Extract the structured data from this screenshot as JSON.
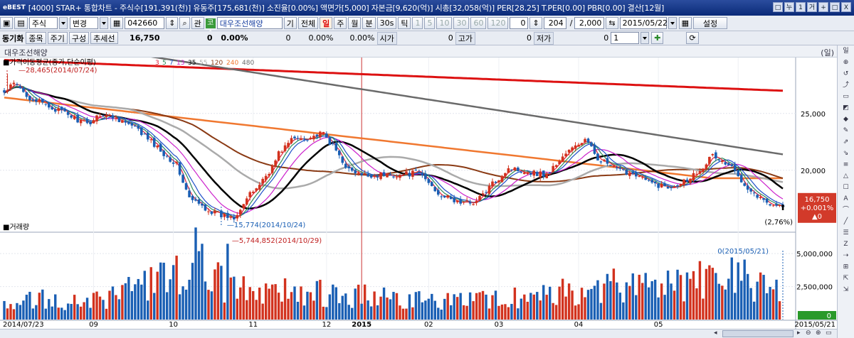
{
  "window": {
    "logo": "eBEST",
    "title": "[4000] STAR+ 통합차트 - 주식수[191,391(천)] 유동주[175,681(천)] 소진율[0.00%] 액면가[5,000] 자본금[9,620(억)] 시총[32,058(억)] PER[28.25] T.PER[0.00] PBR[0.00] 결산[12월]",
    "buttons": [
      "□",
      "누",
      "1",
      "거",
      "+",
      "□",
      "X"
    ]
  },
  "toolbar1": {
    "market": "주식",
    "mode": "변경",
    "code": "042660",
    "search_btn": "관",
    "name_badge": "코스",
    "stock_name": "대우조선해양",
    "buttons": [
      "기",
      "전체",
      "일",
      "주",
      "월",
      "분",
      "30s",
      "틱"
    ],
    "periods": [
      "1",
      "5",
      "10",
      "30",
      "60",
      "120"
    ],
    "count_a": "0",
    "count_b": "204",
    "count_c": "2,000",
    "date": "2015/05/22",
    "settings": "설정"
  },
  "toolbar2": {
    "sync": "동기화",
    "buttons": [
      "종목",
      "주기",
      "구성",
      "추세선"
    ],
    "price": "16,750",
    "change": "0",
    "change_pct": "0.00%",
    "v1": "0",
    "v1p": "0.00%",
    "v2p": "0.00%",
    "labels": [
      "시가",
      "고가",
      "저가"
    ],
    "open": "0",
    "high": "0",
    "low": "0",
    "spin": "1"
  },
  "header": {
    "name": "대우조선해양",
    "period": "(일)"
  },
  "price_panel": {
    "title": "가격이동평균(종가,단순이평)",
    "ma_list": [
      "3",
      "5",
      "7",
      "13",
      "35",
      "55",
      "120",
      "240",
      "480"
    ],
    "high_label": "28,465(2014/07/24)",
    "low_label": "15,774(2014/10/24)",
    "price_tag": [
      "16,750",
      "+0.001%",
      "▲0"
    ],
    "pct_label": "(2,76%)",
    "y_ticks": [
      "25,000",
      "20,000"
    ]
  },
  "volume_panel": {
    "title": "거래량",
    "max_label": "5,744,852(2014/10/29)",
    "last_label": "0(2015/05/21)",
    "y_ticks": [
      "5,000,000",
      "2,500,000"
    ],
    "zero_tag": "0"
  },
  "x_axis": {
    "labels": [
      "2014/07/23",
      "09",
      "10",
      "11",
      "12",
      "2015",
      "02",
      "03",
      "04",
      "05",
      "2015/05/21"
    ]
  },
  "right_tools": [
    "일",
    "⊕",
    "↺",
    "⤴",
    "▭",
    "◩",
    "◆",
    "✎",
    "⇗",
    "⇘",
    "≡",
    "△",
    "☐",
    "A",
    "⌒",
    "╱",
    "☰",
    "Z",
    "⇢",
    "⊞",
    "⇱",
    "⇲"
  ],
  "colors": {
    "up": "#d2321e",
    "down": "#1a5fb4",
    "ma3": "#e0203a",
    "ma5": "#2e8b57",
    "ma7": "#1e50c8",
    "ma13": "#cc22cc",
    "ma35": "#000000",
    "ma55": "#aaaaaa",
    "ma120": "#8a3a14",
    "ma240": "#f07830",
    "ma480": "#6a6a6a",
    "ma_long": "#dd1111"
  },
  "chart_data": {
    "type": "candlestick",
    "x_range": [
      "2014/07/23",
      "2015/05/21"
    ],
    "ylim_price": [
      14800,
      29800
    ],
    "ylim_volume": [
      0,
      6300000
    ],
    "price_high": 28465,
    "price_high_date": "2014/07/24",
    "price_low": 15774,
    "price_low_date": "2014/10/24",
    "last_close": 16750,
    "volume_max": 5744852,
    "volume_max_date": "2014/10/29",
    "anchors": [
      [
        0,
        26800
      ],
      [
        3,
        27600
      ],
      [
        8,
        26400
      ],
      [
        14,
        25600
      ],
      [
        20,
        24900
      ],
      [
        26,
        24000
      ],
      [
        30,
        25000
      ],
      [
        36,
        24500
      ],
      [
        42,
        23500
      ],
      [
        48,
        22000
      ],
      [
        54,
        20500
      ],
      [
        58,
        17500
      ],
      [
        64,
        16500
      ],
      [
        68,
        16000
      ],
      [
        72,
        15900
      ],
      [
        76,
        17500
      ],
      [
        80,
        18800
      ],
      [
        84,
        20300
      ],
      [
        86,
        21500
      ],
      [
        90,
        22700
      ],
      [
        95,
        22900
      ],
      [
        100,
        23200
      ],
      [
        104,
        21700
      ],
      [
        108,
        20000
      ],
      [
        112,
        19500
      ],
      [
        118,
        19600
      ],
      [
        124,
        19600
      ],
      [
        130,
        19800
      ],
      [
        136,
        18000
      ],
      [
        140,
        17400
      ],
      [
        144,
        17100
      ],
      [
        148,
        17300
      ],
      [
        152,
        18500
      ],
      [
        158,
        20200
      ],
      [
        164,
        19900
      ],
      [
        170,
        19600
      ],
      [
        176,
        21500
      ],
      [
        182,
        22700
      ],
      [
        186,
        21100
      ],
      [
        192,
        20000
      ],
      [
        198,
        19700
      ],
      [
        202,
        18900
      ],
      [
        208,
        18500
      ],
      [
        214,
        19200
      ],
      [
        218,
        20100
      ],
      [
        222,
        21300
      ],
      [
        228,
        20200
      ],
      [
        234,
        18200
      ],
      [
        238,
        17300
      ],
      [
        244,
        16750
      ]
    ],
    "ma_long_start": 29700,
    "ma_long_end": 27000,
    "ma480_start": 32000,
    "ma480_end": 21400,
    "volume_profile": [
      [
        0,
        1500000
      ],
      [
        30,
        1500000
      ],
      [
        45,
        2600000
      ],
      [
        55,
        3600000
      ],
      [
        60,
        4800000
      ],
      [
        65,
        3200000
      ],
      [
        75,
        2200000
      ],
      [
        100,
        2000000
      ],
      [
        140,
        1300000
      ],
      [
        160,
        1600000
      ],
      [
        190,
        2500000
      ],
      [
        230,
        3200000
      ],
      [
        244,
        2200000
      ]
    ]
  }
}
